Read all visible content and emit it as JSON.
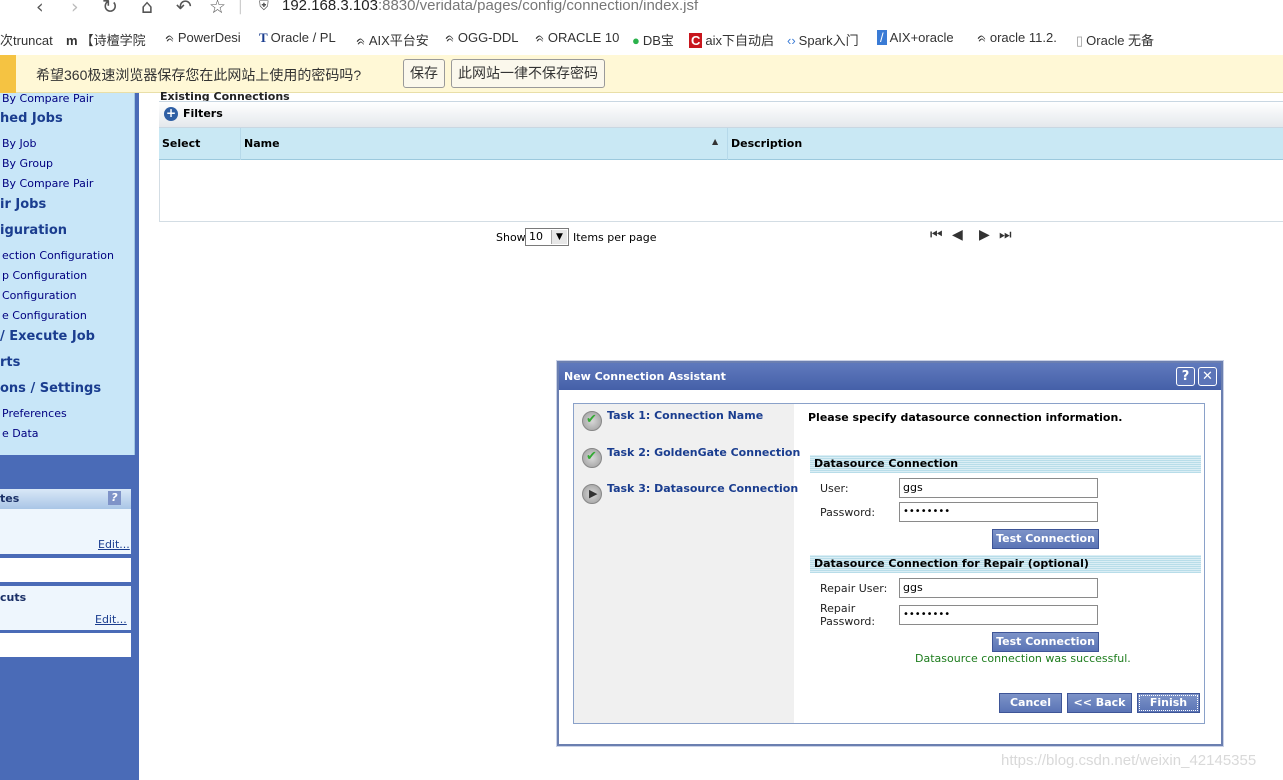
{
  "browser": {
    "url_host": "192.168.3.103",
    "url_path": ":8830/veridata/pages/config/connection/index.jsf",
    "bookmarks": [
      "次truncat",
      "【诗檀学院",
      "PowerDesi",
      "Oracle / PL",
      "AIX平台安",
      "OGG-DDL",
      "ORACLE 10",
      "DB宝",
      "aix下自动启",
      "Spark入门",
      "AIX+oracle",
      "oracle 11.2.",
      "Oracle 无备"
    ],
    "infobar": {
      "message": "希望360极速浏览器保存您在此网站上使用的密码吗?",
      "save_label": "保存",
      "never_label": "此网站一律不保存密码"
    }
  },
  "sidebar": {
    "items": [
      {
        "text": "By Compare Pair",
        "kind": "item"
      },
      {
        "text": "hed Jobs",
        "kind": "head"
      },
      {
        "text": "By Job",
        "kind": "item"
      },
      {
        "text": "By Group",
        "kind": "item"
      },
      {
        "text": "By Compare Pair",
        "kind": "item"
      },
      {
        "text": "ir Jobs",
        "kind": "head"
      },
      {
        "text": "iguration",
        "kind": "head"
      },
      {
        "text": "ection Configuration",
        "kind": "item"
      },
      {
        "text": "p Configuration",
        "kind": "item"
      },
      {
        "text": "Configuration",
        "kind": "item"
      },
      {
        "text": "e Configuration",
        "kind": "item"
      },
      {
        "text": "/ Execute Job",
        "kind": "head"
      },
      {
        "text": "rts",
        "kind": "head"
      },
      {
        "text": "ons / Settings",
        "kind": "head"
      },
      {
        "text": "Preferences",
        "kind": "item"
      },
      {
        "text": "e Data",
        "kind": "item"
      }
    ],
    "notes_title": "tes",
    "notes_edit": "Edit...",
    "shortcuts_title": "cuts",
    "shortcuts_edit": "Edit..."
  },
  "main": {
    "section_title": "Existing Connections",
    "filters_label": "Filters",
    "columns": [
      "Select",
      "Name",
      "Description"
    ],
    "pager": {
      "show_label": "Show",
      "page_size": "10",
      "items_label": "Items per page"
    }
  },
  "dialog": {
    "title": "New Connection Assistant",
    "tasks": [
      "Task 1: Connection Name",
      "Task 2: GoldenGate Connection",
      "Task 3: Datasource Connection"
    ],
    "instruction": "Please specify datasource connection information.",
    "datasource_section": "Datasource Connection",
    "user_label": "User:",
    "user_value": "ggs",
    "password_label": "Password:",
    "password_value": "••••••••",
    "test_label": "Test Connection",
    "repair_section": "Datasource Connection for Repair (optional)",
    "repair_user_label": "Repair User:",
    "repair_user_value": "ggs",
    "repair_password_label_1": "Repair",
    "repair_password_label_2": "Password:",
    "repair_password_value": "••••••••",
    "repair_test_label": "Test Connection",
    "success_msg": "Datasource connection was successful.",
    "cancel_label": "Cancel",
    "back_label": "<< Back",
    "finish_label": "Finish"
  },
  "watermark": "https://blog.csdn.net/weixin_42145355"
}
